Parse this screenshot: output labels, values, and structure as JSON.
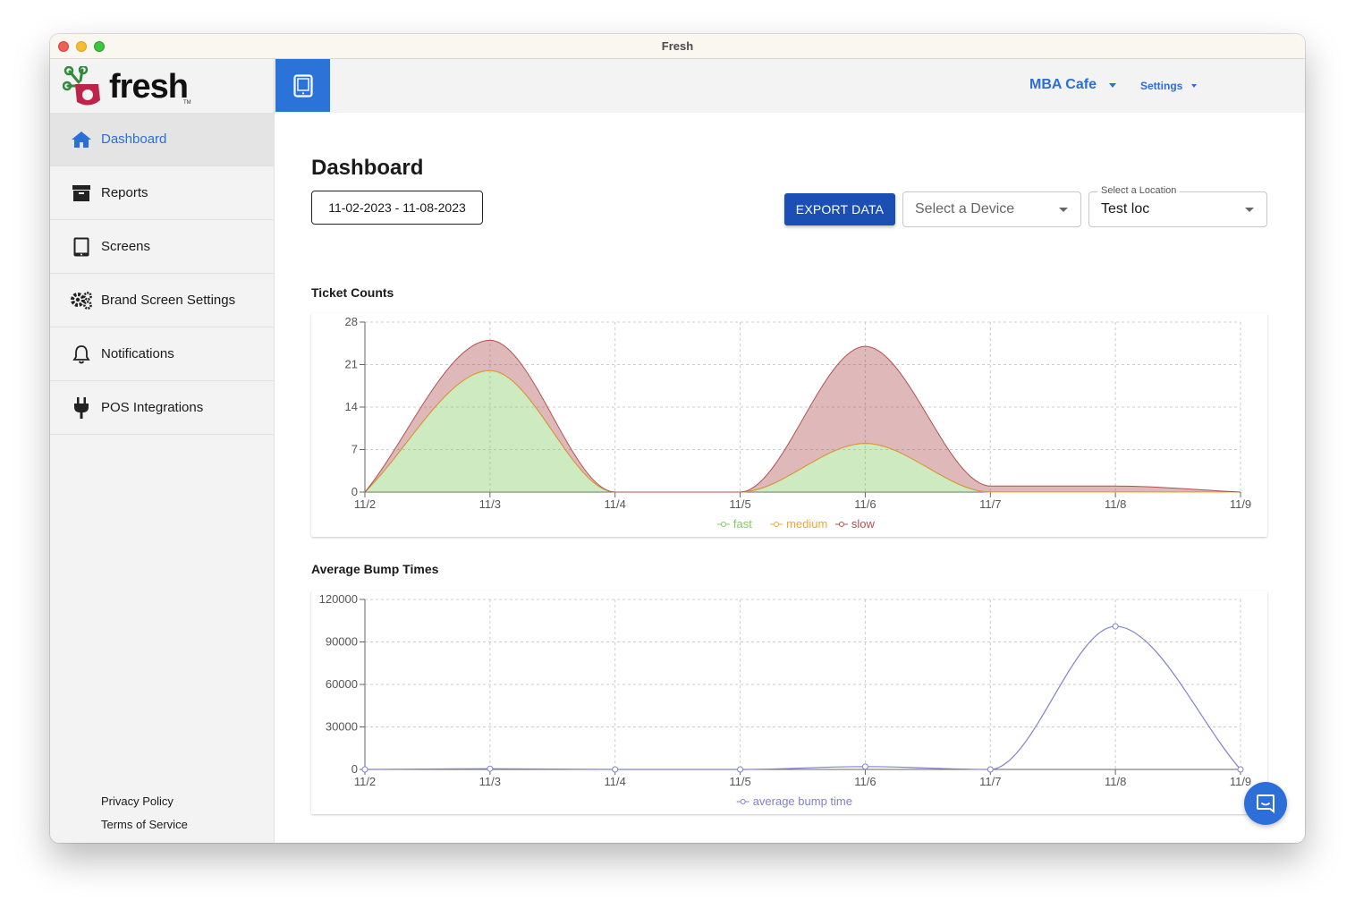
{
  "window": {
    "title": "Fresh"
  },
  "brand": {
    "name": "fresh",
    "tm": "TM"
  },
  "sidebar": {
    "items": [
      {
        "label": "Dashboard",
        "icon": "home-icon",
        "active": true
      },
      {
        "label": "Reports",
        "icon": "archive-icon"
      },
      {
        "label": "Screens",
        "icon": "tablet-icon"
      },
      {
        "label": "Brand Screen Settings",
        "icon": "gears-icon"
      },
      {
        "label": "Notifications",
        "icon": "bell-icon"
      },
      {
        "label": "POS Integrations",
        "icon": "plug-icon"
      }
    ],
    "footer": {
      "privacy": "Privacy Policy",
      "terms": "Terms of Service"
    }
  },
  "topbar": {
    "location_menu": "MBA Cafe",
    "settings_menu": "Settings"
  },
  "dashboard": {
    "title": "Dashboard",
    "date_range": "11-02-2023 - 11-08-2023",
    "export_label": "EXPORT DATA",
    "device_placeholder": "Select a Device",
    "location_legend": "Select a Location",
    "location_value": "Test loc"
  },
  "colors": {
    "accent": "#2a6fd6",
    "export": "#1c4fb4",
    "fast": "#82ca64",
    "medium": "#f0a830",
    "slow": "#b05050",
    "bump": "#8080d0"
  },
  "chart_data": [
    {
      "type": "area",
      "title": "Ticket Counts",
      "categories": [
        "11/2",
        "11/3",
        "11/4",
        "11/5",
        "11/6",
        "11/7",
        "11/8",
        "11/9"
      ],
      "ylim": [
        0,
        28
      ],
      "yticks": [
        0,
        7,
        14,
        21,
        28
      ],
      "stacked": true,
      "grid": true,
      "legend": "bottom",
      "series": [
        {
          "name": "fast",
          "values": [
            0,
            20,
            0,
            0,
            8,
            0,
            0,
            0
          ]
        },
        {
          "name": "medium",
          "values": [
            0,
            0,
            0,
            0,
            0,
            0,
            0,
            0
          ]
        },
        {
          "name": "slow",
          "values": [
            0,
            5,
            0,
            0,
            16,
            1,
            1,
            0
          ]
        }
      ]
    },
    {
      "type": "line",
      "title": "Average Bump Times",
      "categories": [
        "11/2",
        "11/3",
        "11/4",
        "11/5",
        "11/6",
        "11/7",
        "11/8",
        "11/9"
      ],
      "ylim": [
        0,
        120000
      ],
      "yticks": [
        0,
        30000,
        60000,
        90000,
        120000
      ],
      "grid": true,
      "legend": "bottom",
      "series": [
        {
          "name": "average bump time",
          "values": [
            0,
            500,
            0,
            0,
            2000,
            0,
            101000,
            0
          ]
        }
      ]
    }
  ]
}
